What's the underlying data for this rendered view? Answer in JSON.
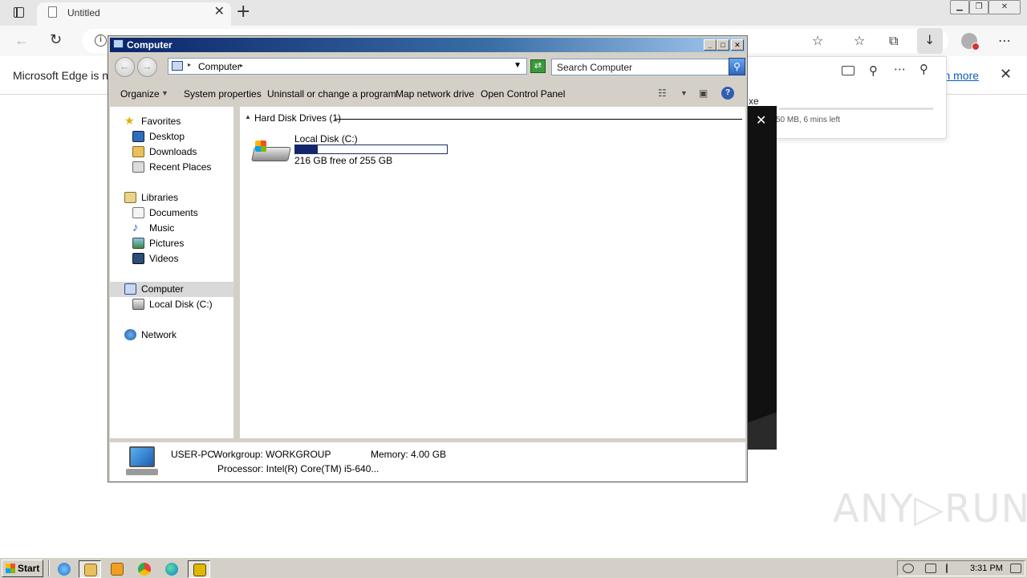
{
  "browser": {
    "tab_title": "Untitled",
    "tab_close_icon": "✕",
    "new_tab_icon": "+",
    "infobar_message": "Microsoft Edge is no",
    "learn_more": "arn more",
    "infobar_close": "✕",
    "downloads": {
      "file_name": "xe",
      "status": "50 MB, 6 mins left"
    }
  },
  "explorer": {
    "title": "Computer",
    "address": {
      "location": "Computer"
    },
    "search_placeholder": "Search Computer",
    "commands": [
      "Organize",
      "System properties",
      "Uninstall or change a program",
      "Map network drive",
      "Open Control Panel"
    ],
    "nav": {
      "favorites": {
        "label": "Favorites",
        "items": [
          "Desktop",
          "Downloads",
          "Recent Places"
        ]
      },
      "libraries": {
        "label": "Libraries",
        "items": [
          "Documents",
          "Music",
          "Pictures",
          "Videos"
        ]
      },
      "computer": {
        "label": "Computer",
        "items": [
          "Local Disk (C:)"
        ]
      },
      "network": {
        "label": "Network"
      }
    },
    "group_header": "Hard Disk Drives (1)",
    "drive": {
      "name": "Local Disk (C:)",
      "free_text": "216 GB free of 255 GB",
      "used_fraction": 0.15
    },
    "details": {
      "pc_name": "USER-PC",
      "workgroup": "Workgroup: WORKGROUP",
      "memory": "Memory: 4.00 GB",
      "processor": "Processor: Intel(R) Core(TM) i5-640..."
    }
  },
  "watermark": "ANY▷RUN",
  "taskbar": {
    "start_label": "Start",
    "clock": "3:31 PM"
  }
}
